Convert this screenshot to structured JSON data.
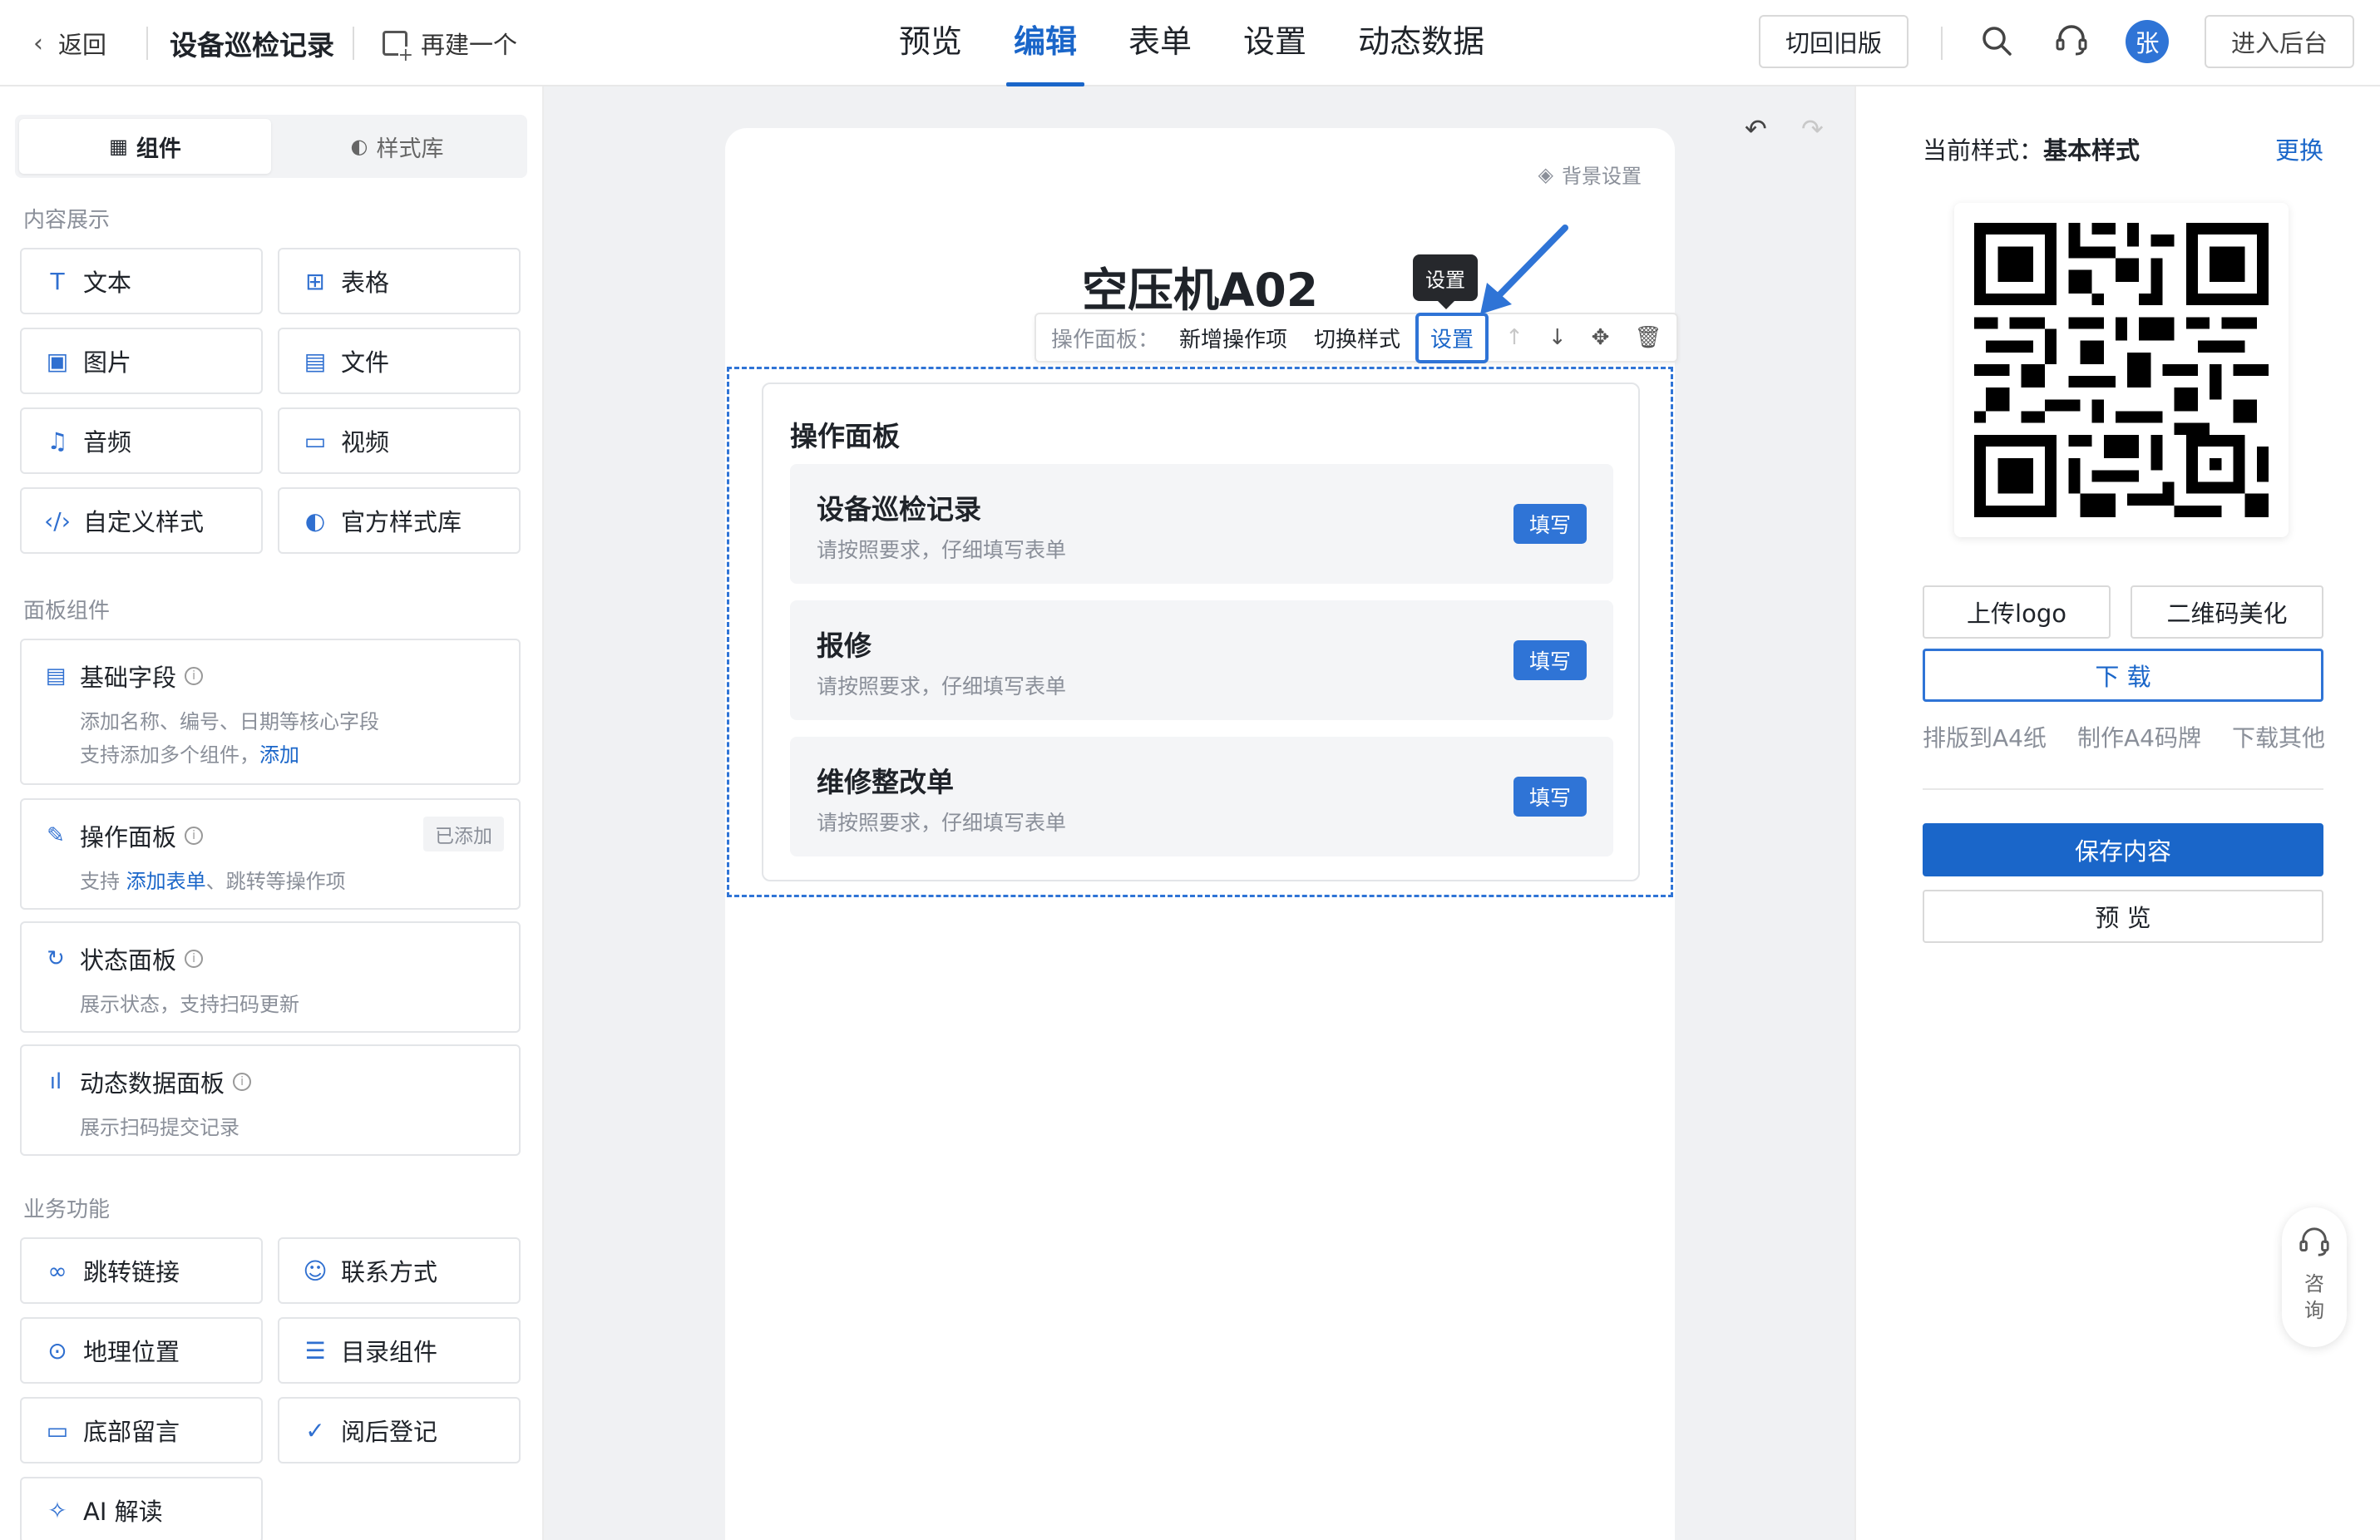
{
  "header": {
    "back_label": "返回",
    "title": "设备巡检记录",
    "new_label": "再建一个",
    "tabs": [
      "预览",
      "编辑",
      "表单",
      "设置",
      "动态数据"
    ],
    "active_tab": "编辑",
    "switch_old_label": "切回旧版",
    "avatar_text": "张",
    "admin_label": "进入后台"
  },
  "sidebar": {
    "tab_components": "组件",
    "tab_style_lib": "样式库",
    "section_content": "内容展示",
    "content_items": [
      {
        "label": "文本",
        "icon": "text-icon"
      },
      {
        "label": "表格",
        "icon": "table-icon"
      },
      {
        "label": "图片",
        "icon": "image-icon"
      },
      {
        "label": "文件",
        "icon": "file-icon"
      },
      {
        "label": "音频",
        "icon": "audio-icon"
      },
      {
        "label": "视频",
        "icon": "video-icon"
      },
      {
        "label": "自定义样式",
        "icon": "code-icon"
      },
      {
        "label": "官方样式库",
        "icon": "palette-icon"
      }
    ],
    "section_panel": "面板组件",
    "panel_cards": [
      {
        "title": "基础字段",
        "desc1": "添加名称、编号、日期等核心字段",
        "desc2": "支持添加多个组件，",
        "link": "添加"
      },
      {
        "title": "操作面板",
        "badge": "已添加",
        "desc_pre": "支持 ",
        "link": "添加表单",
        "desc_post": "、跳转等操作项"
      },
      {
        "title": "状态面板",
        "desc1": "展示状态，支持扫码更新"
      },
      {
        "title": "动态数据面板",
        "desc1": "展示扫码提交记录"
      }
    ],
    "section_business": "业务功能",
    "business_items": [
      {
        "label": "跳转链接",
        "icon": "link-icon"
      },
      {
        "label": "联系方式",
        "icon": "contact-icon"
      },
      {
        "label": "地理位置",
        "icon": "location-icon"
      },
      {
        "label": "目录组件",
        "icon": "list-icon"
      },
      {
        "label": "底部留言",
        "icon": "message-icon"
      },
      {
        "label": "阅后登记",
        "icon": "check-file-icon"
      },
      {
        "label": "AI 解读",
        "icon": "sparkle-icon"
      }
    ]
  },
  "canvas": {
    "bg_setting": "背景设置",
    "page_title": "空压机A02",
    "tooltip": "设置",
    "toolbar": {
      "label": "操作面板：",
      "add_item": "新增操作项",
      "switch_style": "切换样式",
      "settings": "设置"
    },
    "panel": {
      "title": "操作面板",
      "items": [
        {
          "title": "设备巡检记录",
          "desc": "请按照要求，仔细填写表单",
          "button": "填写"
        },
        {
          "title": "报修",
          "desc": "请按照要求，仔细填写表单",
          "button": "填写"
        },
        {
          "title": "维修整改单",
          "desc": "请按照要求，仔细填写表单",
          "button": "填写"
        }
      ]
    }
  },
  "right_panel": {
    "current_style_label": "当前样式：",
    "current_style_value": "基本样式",
    "change_label": "更换",
    "upload_logo": "上传logo",
    "qr_beautify": "二维码美化",
    "download": "下 载",
    "links": [
      "排版到A4纸",
      "制作A4码牌",
      "下载其他"
    ],
    "save": "保存内容",
    "preview": "预 览"
  },
  "consult": {
    "chars": [
      "咨",
      "询"
    ]
  },
  "colors": {
    "primary": "#1a66c9",
    "accent": "#2f74d6",
    "canvas_bg": "#f0f1f3"
  }
}
